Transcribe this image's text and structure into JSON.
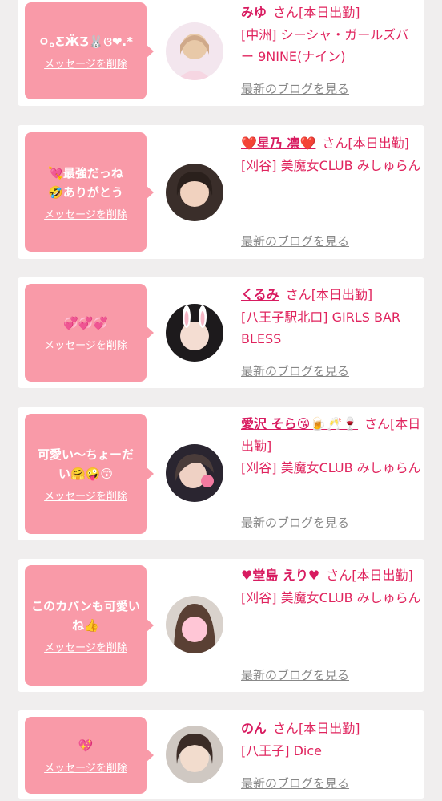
{
  "cards": [
    {
      "message": "ㅇ｡ƸӜƷ🐰ଓ❤︎.*",
      "delete_label": "メッセージを削除",
      "name": "みゆ",
      "san_status": "さん[本日出勤]",
      "shop": "[中洲] シーシャ・ガールズバー 9NINE(ナイン)",
      "blog_label": "最新のブログを見る"
    },
    {
      "message": "💘最強だっね🤣ありがとう",
      "delete_label": "メッセージを削除",
      "name": "❤️星乃 凛❤️",
      "san_status": "さん[本日出勤]",
      "shop": "[刈谷] 美魔女CLUB みしゅらん",
      "blog_label": "最新のブログを見る"
    },
    {
      "message": "💞💞💞",
      "delete_label": "メッセージを削除",
      "name": "くるみ",
      "san_status": "さん[本日出勤]",
      "shop": "[八王子駅北口] GIRLS BAR BLESS",
      "blog_label": "最新のブログを見る"
    },
    {
      "message": "可愛い〜ちょーだい🤗🤪😙",
      "delete_label": "メッセージを削除",
      "name": "愛沢 そら😘🍺🥂🍷",
      "san_status": "さん[本日出勤]",
      "shop": "[刈谷] 美魔女CLUB みしゅらん",
      "blog_label": "最新のブログを見る"
    },
    {
      "message": "このカバンも可愛いね👍",
      "delete_label": "メッセージを削除",
      "name": "♥堂島 えり♥",
      "san_status": "さん[本日出勤]",
      "shop": "[刈谷] 美魔女CLUB みしゅらん",
      "blog_label": "最新のブログを見る"
    },
    {
      "message": "💖",
      "delete_label": "メッセージを削除",
      "name": "のん",
      "san_status": "さん[本日出勤]",
      "shop": "[八王子] Dice",
      "blog_label": "最新のブログを見る"
    }
  ],
  "colors": {
    "bubble": "#f99aa8",
    "name": "#d81b60",
    "text": "#e0245e",
    "link_grey": "#888888"
  }
}
